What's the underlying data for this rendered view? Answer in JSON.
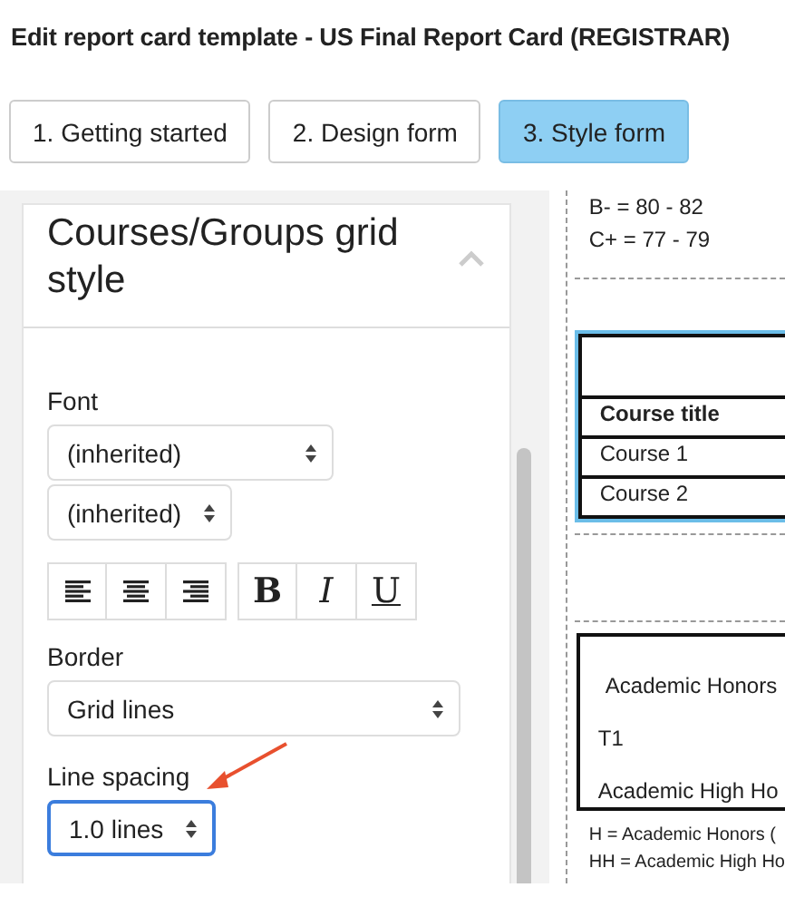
{
  "title": "Edit report card template - US Final Report Card (REGISTRAR)",
  "steps": [
    {
      "label": "1. Getting started",
      "selected": false
    },
    {
      "label": "2. Design form",
      "selected": false
    },
    {
      "label": "3. Style form",
      "selected": true
    }
  ],
  "panel": {
    "heading": "Courses/Groups grid style",
    "expanded": true,
    "font_label": "Font",
    "font_family": "(inherited)",
    "font_size": "(inherited)",
    "align_buttons": [
      {
        "kind": "left"
      },
      {
        "kind": "center"
      },
      {
        "kind": "right"
      }
    ],
    "style_buttons": [
      {
        "label": "B",
        "kind": "bold"
      },
      {
        "label": "I",
        "kind": "italic"
      },
      {
        "label": "U",
        "kind": "underline"
      }
    ],
    "border_label": "Border",
    "border": "Grid lines",
    "spacing_label": "Line spacing",
    "spacing": "1.0 lines",
    "spacing_focused": true
  },
  "preview": {
    "grading_lines": [
      "B- = 80 - 82",
      "C+ = 77 - 79"
    ],
    "grid_table": {
      "selected": true,
      "header": "Course title",
      "rows": [
        "Course 1",
        "Course 2"
      ]
    },
    "honors_lines": [
      "Academic Honors",
      "T1",
      "Academic High Ho"
    ],
    "footnotes": [
      "H = Academic Honors (",
      "HH = Academic High Ho"
    ]
  }
}
